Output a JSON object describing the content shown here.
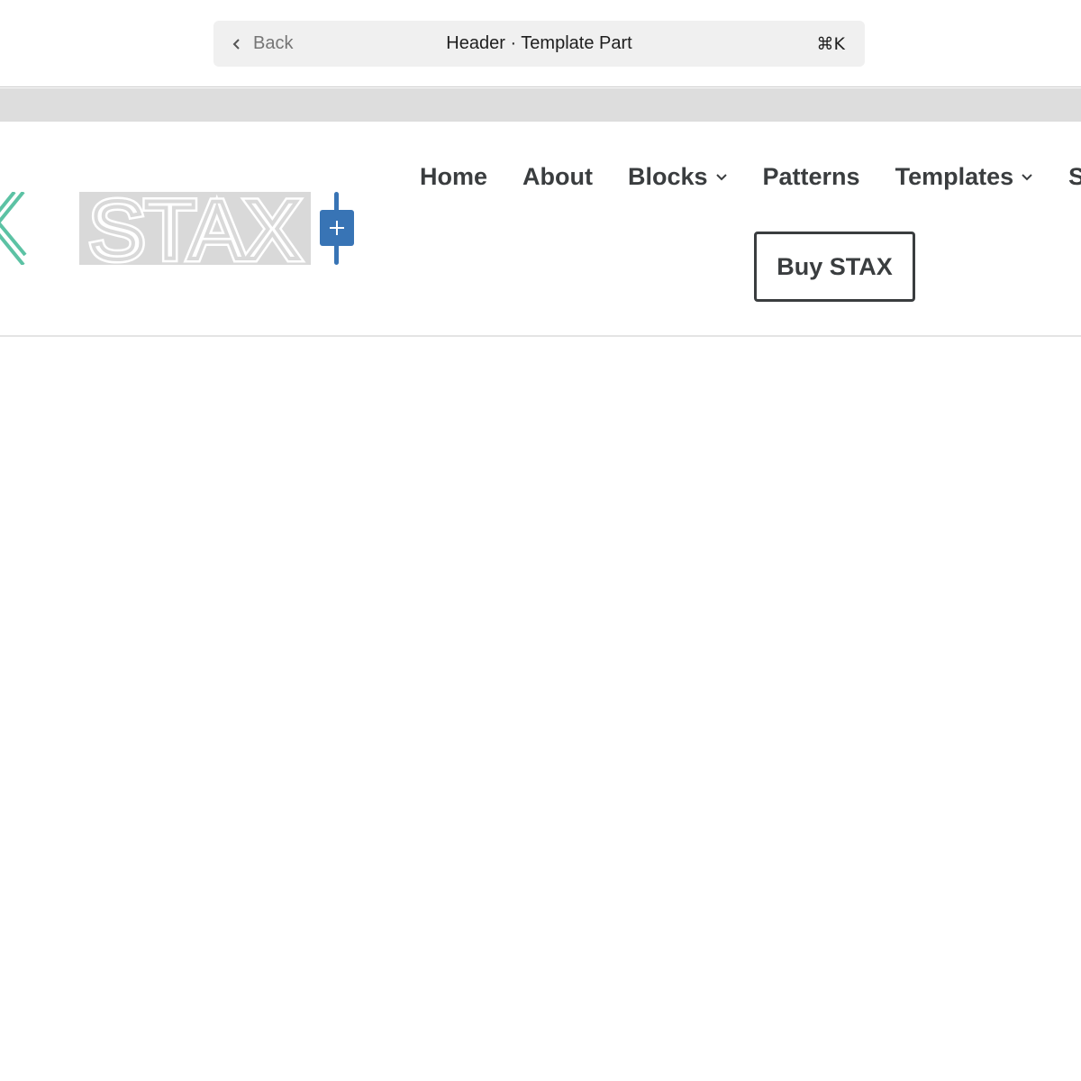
{
  "command_center": {
    "back_label": "Back",
    "title": "Header · Template Part",
    "shortcut": "⌘K"
  },
  "site_header": {
    "logo_icon": "stax-x-logo-icon",
    "site_title": "STAX",
    "inserter_icon": "plus-icon",
    "nav": {
      "items": [
        {
          "label": "Home",
          "has_submenu": false
        },
        {
          "label": "About",
          "has_submenu": false
        },
        {
          "label": "Blocks",
          "has_submenu": true
        },
        {
          "label": "Patterns",
          "has_submenu": false
        },
        {
          "label": "Templates",
          "has_submenu": true
        },
        {
          "label": "Sh",
          "has_submenu": false
        }
      ]
    },
    "buy_button_label": "Buy STAX"
  },
  "colors": {
    "accent": "#3874b5",
    "text": "#3a3d3f",
    "logo_teal": "#5cc2a4"
  }
}
